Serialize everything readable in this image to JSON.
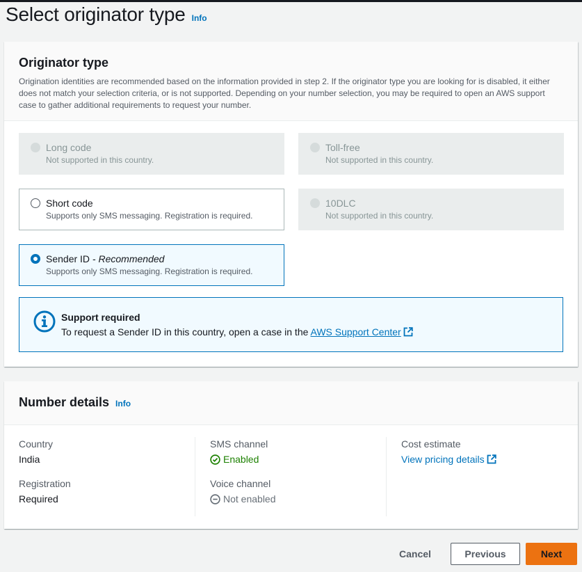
{
  "page": {
    "title": "Select originator type",
    "info": "Info"
  },
  "originator": {
    "title": "Originator type",
    "description": "Origination identities are recommended based on the information provided in step 2. If the originator type you are looking for is disabled, it either does not match your selection criteria, or is not supported. Depending on your number selection, you may be required to open an AWS support case to gather additional requirements to request your number.",
    "options": [
      {
        "label": "Long code",
        "desc": "Not supported in this country.",
        "state": "disabled"
      },
      {
        "label": "Toll-free",
        "desc": "Not supported in this country.",
        "state": "disabled"
      },
      {
        "label": "Short code",
        "desc": "Supports only SMS messaging. Registration is required.",
        "state": "enabled"
      },
      {
        "label": "10DLC",
        "desc": "Not supported in this country.",
        "state": "disabled"
      },
      {
        "label": "Sender ID",
        "label_suffix": " - Recommended",
        "desc": "Supports only SMS messaging. Registration is required.",
        "state": "selected"
      }
    ],
    "alert": {
      "title": "Support required",
      "text": "To request a Sender ID in this country, open a case in the ",
      "link": "AWS Support Center"
    }
  },
  "number_details": {
    "title": "Number details",
    "info": "Info",
    "country_key": "Country",
    "country_val": "India",
    "registration_key": "Registration",
    "registration_val": "Required",
    "sms_key": "SMS channel",
    "sms_val": "Enabled",
    "voice_key": "Voice channel",
    "voice_val": "Not enabled",
    "cost_key": "Cost estimate",
    "cost_link": "View pricing details"
  },
  "footer": {
    "cancel": "Cancel",
    "previous": "Previous",
    "next": "Next"
  },
  "colors": {
    "accent": "#0073bb",
    "primary_button": "#ec7211",
    "success": "#1d8102"
  }
}
